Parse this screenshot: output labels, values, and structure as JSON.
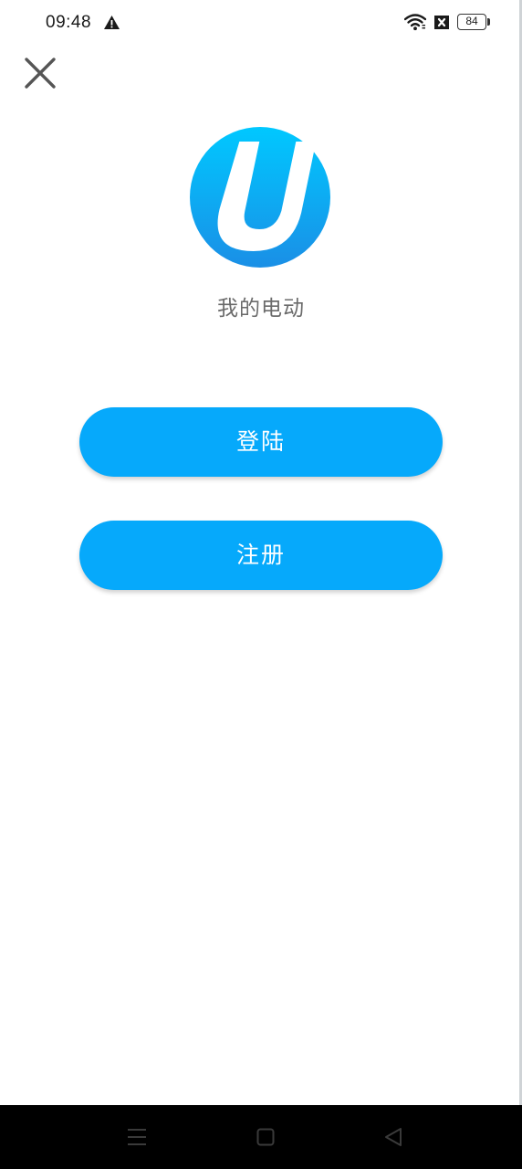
{
  "status_bar": {
    "time": "09:48",
    "battery_level": "84",
    "icons": [
      "warning-icon",
      "wifi-icon",
      "sim-missing-icon",
      "battery-icon"
    ]
  },
  "header": {
    "close_icon": "close-icon"
  },
  "brand": {
    "logo_icon": "app-logo-u",
    "app_name": "我的电动"
  },
  "actions": {
    "login_label": "登陆",
    "register_label": "注册"
  },
  "nav_bar": {
    "icons": [
      "menu-icon",
      "home-icon",
      "back-icon"
    ]
  },
  "colors": {
    "accent": "#06a9fb",
    "logo_gradient_top": "#00c8ff",
    "logo_gradient_bottom": "#1a8fe6",
    "app_name_text": "#6b6b6b",
    "nav_background": "#000000"
  }
}
